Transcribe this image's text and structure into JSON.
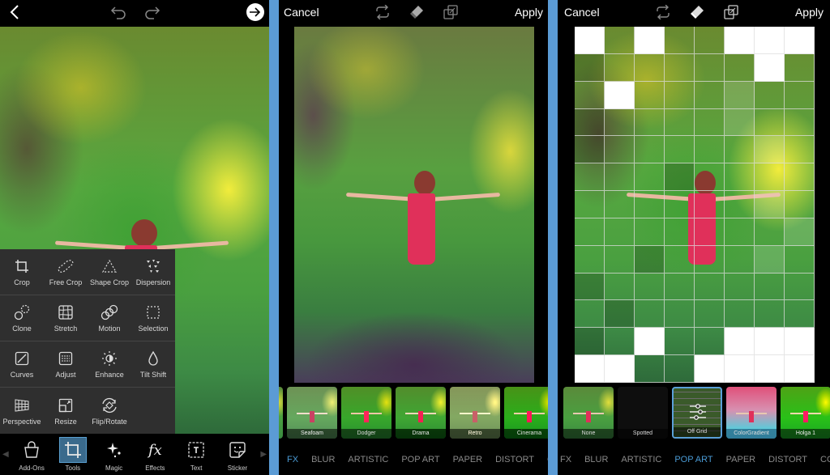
{
  "panel1": {
    "topbar": {
      "back_icon": "chevron-left-icon",
      "undo_icon": "undo-icon",
      "redo_icon": "redo-icon",
      "next_icon": "arrow-right-circle-icon"
    },
    "tools": [
      [
        {
          "label": "Crop",
          "icon": "crop-icon"
        },
        {
          "label": "Free Crop",
          "icon": "free-crop-icon"
        },
        {
          "label": "Shape Crop",
          "icon": "shape-crop-icon"
        },
        {
          "label": "Dispersion",
          "icon": "dispersion-icon"
        }
      ],
      [
        {
          "label": "Clone",
          "icon": "clone-icon"
        },
        {
          "label": "Stretch",
          "icon": "stretch-icon"
        },
        {
          "label": "Motion",
          "icon": "motion-icon"
        },
        {
          "label": "Selection",
          "icon": "selection-icon"
        }
      ],
      [
        {
          "label": "Curves",
          "icon": "curves-icon"
        },
        {
          "label": "Adjust",
          "icon": "adjust-icon"
        },
        {
          "label": "Enhance",
          "icon": "enhance-icon"
        },
        {
          "label": "Tilt Shift",
          "icon": "tilt-shift-icon"
        }
      ],
      [
        {
          "label": "Perspective",
          "icon": "perspective-icon"
        },
        {
          "label": "Resize",
          "icon": "resize-icon"
        },
        {
          "label": "Flip/Rotate",
          "icon": "flip-rotate-icon"
        }
      ]
    ],
    "bottom_nav": [
      {
        "label": "Add-Ons",
        "icon": "shopping-bag-icon",
        "active": false
      },
      {
        "label": "Tools",
        "icon": "crop-icon",
        "active": true
      },
      {
        "label": "Magic",
        "icon": "sparkle-icon",
        "active": false
      },
      {
        "label": "Effects",
        "icon": "fx-icon",
        "active": false
      },
      {
        "label": "Text",
        "icon": "text-icon",
        "active": false
      },
      {
        "label": "Sticker",
        "icon": "sticker-icon",
        "active": false
      }
    ]
  },
  "panel2": {
    "topbar": {
      "cancel": "Cancel",
      "apply": "Apply"
    },
    "filters": [
      "Seafoam",
      "Dodger",
      "Drama",
      "Retro",
      "Cinerama"
    ],
    "categories": [
      "FX",
      "BLUR",
      "ARTISTIC",
      "POP ART",
      "PAPER",
      "DISTORT",
      "C"
    ],
    "active_category": "FX"
  },
  "panel3": {
    "topbar": {
      "cancel": "Cancel",
      "apply": "Apply"
    },
    "filters": [
      "None",
      "Spotted",
      "Off Grid",
      "ColorGradient",
      "Holga 1"
    ],
    "selected_filter": "Off Grid",
    "categories": [
      "FX",
      "BLUR",
      "ARTISTIC",
      "POP ART",
      "PAPER",
      "DISTORT",
      "CO"
    ],
    "active_category": "POP ART"
  },
  "colors": {
    "accent": "#4a9ad4",
    "divider": "#5b9bd5",
    "menu_bg": "#2f2f2f"
  }
}
